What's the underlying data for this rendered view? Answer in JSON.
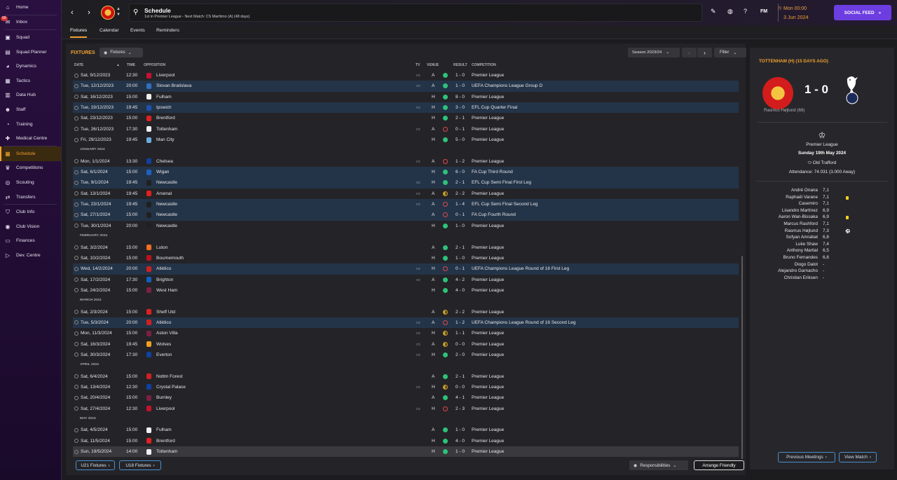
{
  "sidebar": {
    "items": [
      {
        "label": "Home",
        "icon": "home-icon",
        "glyph": "⌂"
      },
      {
        "label": "Inbox",
        "icon": "inbox-icon",
        "glyph": "✉",
        "badge": "99"
      },
      {
        "label": "Squad",
        "icon": "squad-icon",
        "glyph": "▣"
      },
      {
        "label": "Squad Planner",
        "icon": "squad-planner-icon",
        "glyph": "▤"
      },
      {
        "label": "Dynamics",
        "icon": "dynamics-icon",
        "glyph": "◕"
      },
      {
        "label": "Tactics",
        "icon": "tactics-icon",
        "glyph": "▦"
      },
      {
        "label": "Data Hub",
        "icon": "data-hub-icon",
        "glyph": "▥"
      },
      {
        "label": "Staff",
        "icon": "staff-icon",
        "glyph": "☻"
      },
      {
        "label": "Training",
        "icon": "training-icon",
        "glyph": "◔"
      },
      {
        "label": "Medical Centre",
        "icon": "medical-icon",
        "glyph": "✚"
      },
      {
        "label": "Schedule",
        "icon": "calendar-icon",
        "glyph": "▦",
        "active": true
      },
      {
        "label": "Competitions",
        "icon": "trophy-icon",
        "glyph": "♛"
      },
      {
        "label": "Scouting",
        "icon": "scouting-icon",
        "glyph": "◎"
      },
      {
        "label": "Transfers",
        "icon": "transfers-icon",
        "glyph": "⇄"
      },
      {
        "label": "Club Info",
        "icon": "shield-icon",
        "glyph": "⛉"
      },
      {
        "label": "Club Vision",
        "icon": "eye-icon",
        "glyph": "◉"
      },
      {
        "label": "Finances",
        "icon": "finances-icon",
        "glyph": "▭"
      },
      {
        "label": "Dev. Centre",
        "icon": "dev-centre-icon",
        "glyph": "▷"
      }
    ]
  },
  "header": {
    "title": "Schedule",
    "subtitle": "1st in Premier League - Next Match: CS Marítimo (A) (48 days)",
    "date_time": "Mon 00:00",
    "date": "3 Jun 2024",
    "fm_label": "FM",
    "social_feed": "SOCIAL FEED"
  },
  "tabs": [
    "Fixtures",
    "Calendar",
    "Events",
    "Reminders"
  ],
  "fixtures": {
    "heading": "FIXTURES",
    "view_dropdown": "Fixtures",
    "season": "Season 2023/24",
    "filter": "Filter",
    "columns": {
      "date": "DATE",
      "time": "TIME",
      "opposition": "OPPOSITION",
      "tv": "TV",
      "venue": "VENUE",
      "result": "RESULT",
      "competition": "COMPETITION"
    },
    "rows": [
      {
        "date": "Sat, 9/12/2023",
        "time": "12:30",
        "opp": "Liverpool",
        "tv": true,
        "venue": "A",
        "res": "W",
        "score": "1 - 0",
        "comp": "Premier League",
        "color": "#c8102e"
      },
      {
        "date": "Tue, 12/12/2023",
        "time": "20:00",
        "opp": "Slovan Bratislava",
        "tv": true,
        "venue": "A",
        "res": "W",
        "score": "1 - 0",
        "comp": "UEFA Champions League Group D",
        "color": "#3070c0",
        "hl": true
      },
      {
        "date": "Sat, 16/12/2023",
        "time": "15:00",
        "opp": "Fulham",
        "tv": false,
        "venue": "H",
        "res": "W",
        "score": "8 - 0",
        "comp": "Premier League",
        "color": "#f0f0f0"
      },
      {
        "date": "Tue, 19/12/2023",
        "time": "19:45",
        "opp": "Ipswich",
        "tv": true,
        "venue": "H",
        "res": "W",
        "score": "3 - 0",
        "comp": "EFL Cup Quarter Final",
        "color": "#2050b0",
        "hl": true
      },
      {
        "date": "Sat, 23/12/2023",
        "time": "15:00",
        "opp": "Brentford",
        "tv": false,
        "venue": "H",
        "res": "W",
        "score": "2 - 1",
        "comp": "Premier League",
        "color": "#e02020"
      },
      {
        "date": "Tue, 26/12/2023",
        "time": "17:30",
        "opp": "Tottenham",
        "tv": true,
        "venue": "A",
        "res": "L",
        "score": "0 - 1",
        "comp": "Premier League",
        "color": "#f0f0f0"
      },
      {
        "date": "Fri, 29/12/2023",
        "time": "19:45",
        "opp": "Man City",
        "tv": false,
        "venue": "H",
        "res": "W",
        "score": "5 - 0",
        "comp": "Premier League",
        "color": "#6cabdd"
      },
      {
        "month": "JANUARY 2024"
      },
      {
        "date": "Mon, 1/1/2024",
        "time": "13:30",
        "opp": "Chelsea",
        "tv": true,
        "venue": "A",
        "res": "L",
        "score": "1 - 2",
        "comp": "Premier League",
        "color": "#1040a0"
      },
      {
        "date": "Sat, 6/1/2024",
        "time": "15:00",
        "opp": "Wigan",
        "tv": false,
        "venue": "H",
        "res": "W",
        "score": "6 - 0",
        "comp": "FA Cup Third Round",
        "color": "#2060c0",
        "hl": true
      },
      {
        "date": "Tue, 9/1/2024",
        "time": "19:45",
        "opp": "Newcastle",
        "tv": true,
        "venue": "H",
        "res": "W",
        "score": "2 - 1",
        "comp": "EFL Cup Semi Final First Leg",
        "color": "#202020",
        "hl": true
      },
      {
        "date": "Sat, 13/1/2024",
        "time": "19:45",
        "opp": "Arsenal",
        "tv": true,
        "venue": "A",
        "res": "D",
        "score": "2 - 2",
        "comp": "Premier League",
        "color": "#e02020"
      },
      {
        "date": "Tue, 23/1/2024",
        "time": "19:45",
        "opp": "Newcastle",
        "tv": true,
        "venue": "A",
        "res": "L",
        "score": "1 - 4",
        "comp": "EFL Cup Semi Final Second Leg",
        "color": "#202020",
        "hl": true
      },
      {
        "date": "Sat, 27/1/2024",
        "time": "15:00",
        "opp": "Newcastle",
        "tv": false,
        "venue": "A",
        "res": "L",
        "score": "0 - 1",
        "comp": "FA Cup Fourth Round",
        "color": "#202020",
        "hl": true
      },
      {
        "date": "Tue, 30/1/2024",
        "time": "20:00",
        "opp": "Newcastle",
        "tv": false,
        "venue": "H",
        "res": "W",
        "score": "1 - 0",
        "comp": "Premier League",
        "color": "#202020"
      },
      {
        "month": "FEBRUARY 2024"
      },
      {
        "date": "Sat, 3/2/2024",
        "time": "15:00",
        "opp": "Luton",
        "tv": false,
        "venue": "A",
        "res": "W",
        "score": "2 - 1",
        "comp": "Premier League",
        "color": "#f07020"
      },
      {
        "date": "Sat, 10/2/2024",
        "time": "15:00",
        "opp": "Bournemouth",
        "tv": false,
        "venue": "H",
        "res": "W",
        "score": "1 - 0",
        "comp": "Premier League",
        "color": "#c01020"
      },
      {
        "date": "Wed, 14/2/2024",
        "time": "20:00",
        "opp": "Atlético",
        "tv": true,
        "venue": "H",
        "res": "L",
        "score": "0 - 1",
        "comp": "UEFA Champions League Round of 16 First Leg",
        "color": "#d02020",
        "hl": true
      },
      {
        "date": "Sat, 17/2/2024",
        "time": "17:30",
        "opp": "Brighton",
        "tv": true,
        "venue": "A",
        "res": "W",
        "score": "4 - 2",
        "comp": "Premier League",
        "color": "#1060c0"
      },
      {
        "date": "Sat, 24/2/2024",
        "time": "15:00",
        "opp": "West Ham",
        "tv": false,
        "venue": "H",
        "res": "W",
        "score": "4 - 0",
        "comp": "Premier League",
        "color": "#7a2040"
      },
      {
        "month": "MARCH 2024"
      },
      {
        "date": "Sat, 2/3/2024",
        "time": "15:00",
        "opp": "Sheff Utd",
        "tv": false,
        "venue": "A",
        "res": "D",
        "score": "2 - 2",
        "comp": "Premier League",
        "color": "#e02020"
      },
      {
        "date": "Tue, 5/3/2024",
        "time": "20:00",
        "opp": "Atlético",
        "tv": true,
        "venue": "A",
        "res": "L",
        "score": "1 - 2",
        "comp": "UEFA Champions League Round of 16 Second Leg",
        "color": "#d02020",
        "hl": true
      },
      {
        "date": "Mon, 11/3/2024",
        "time": "15:00",
        "opp": "Aston Villa",
        "tv": true,
        "venue": "H",
        "res": "D",
        "score": "1 - 1",
        "comp": "Premier League",
        "color": "#7a2040"
      },
      {
        "date": "Sat, 16/3/2024",
        "time": "19:45",
        "opp": "Wolves",
        "tv": true,
        "venue": "A",
        "res": "D",
        "score": "0 - 0",
        "comp": "Premier League",
        "color": "#f0a020"
      },
      {
        "date": "Sat, 30/3/2024",
        "time": "17:30",
        "opp": "Everton",
        "tv": true,
        "venue": "H",
        "res": "W",
        "score": "2 - 0",
        "comp": "Premier League",
        "color": "#1040a0"
      },
      {
        "month": "APRIL 2024"
      },
      {
        "date": "Sat, 6/4/2024",
        "time": "15:00",
        "opp": "Nottm Forest",
        "tv": false,
        "venue": "A",
        "res": "W",
        "score": "2 - 1",
        "comp": "Premier League",
        "color": "#d02020"
      },
      {
        "date": "Sat, 13/4/2024",
        "time": "12:30",
        "opp": "Crystal Palace",
        "tv": true,
        "venue": "H",
        "res": "D",
        "score": "0 - 0",
        "comp": "Premier League",
        "color": "#1040a0"
      },
      {
        "date": "Sat, 20/4/2024",
        "time": "15:00",
        "opp": "Burnley",
        "tv": false,
        "venue": "A",
        "res": "W",
        "score": "4 - 1",
        "comp": "Premier League",
        "color": "#7a2040"
      },
      {
        "date": "Sat, 27/4/2024",
        "time": "12:30",
        "opp": "Liverpool",
        "tv": true,
        "venue": "H",
        "res": "L",
        "score": "2 - 3",
        "comp": "Premier League",
        "color": "#c8102e"
      },
      {
        "month": "MAY 2024"
      },
      {
        "date": "Sat, 4/5/2024",
        "time": "15:00",
        "opp": "Fulham",
        "tv": false,
        "venue": "A",
        "res": "W",
        "score": "1 - 0",
        "comp": "Premier League",
        "color": "#f0f0f0"
      },
      {
        "date": "Sat, 11/5/2024",
        "time": "15:00",
        "opp": "Brentford",
        "tv": false,
        "venue": "H",
        "res": "W",
        "score": "4 - 0",
        "comp": "Premier League",
        "color": "#e02020"
      },
      {
        "date": "Sun, 19/5/2024",
        "time": "14:00",
        "opp": "Tottenham",
        "tv": false,
        "venue": "H",
        "res": "W",
        "score": "1 - 0",
        "comp": "Premier League",
        "color": "#f0f0f0",
        "last": true
      }
    ],
    "u21": "U21 Fixtures",
    "u18": "U18 Fixtures",
    "responsibilities": "Responsibilities",
    "arrange_friendly": "Arrange Friendly"
  },
  "match_panel": {
    "title": "TOTTENHAM (H) (15 DAYS AGO)",
    "score": "1 - 0",
    "scorer": "Rasmus Højlund (66)",
    "competition": "Premier League",
    "date": "Sunday 19th May 2024",
    "stadium": "Old Trafford",
    "attendance": "Attendance: 74.031 (3.000 Away)",
    "players": [
      {
        "name": "André Onana",
        "rating": "7,1"
      },
      {
        "name": "Raphaël Varane",
        "rating": "7,1",
        "card": true
      },
      {
        "name": "Casemiro",
        "rating": "7,1"
      },
      {
        "name": "Lisandro Martínez",
        "rating": "6,9"
      },
      {
        "name": "Aaron Wan-Bissaka",
        "rating": "6,9",
        "card": true
      },
      {
        "name": "Marcus Rashford",
        "rating": "7,1"
      },
      {
        "name": "Rasmus Højlund",
        "rating": "7,3",
        "goal": true
      },
      {
        "name": "Sofyan Amrabat",
        "rating": "6,8"
      },
      {
        "name": "Luke Shaw",
        "rating": "7,4"
      },
      {
        "name": "Anthony Martial",
        "rating": "6,5"
      },
      {
        "name": "Bruno Fernandes",
        "rating": "6,6"
      },
      {
        "name": "Diogo Dalot",
        "rating": "-"
      },
      {
        "name": "Alejandro Garnacho",
        "rating": "-"
      },
      {
        "name": "Christian Eriksen",
        "rating": "-"
      }
    ],
    "previous_meetings": "Previous Meetings",
    "view_match": "View Match"
  },
  "colors": {
    "accent": "#f0a030",
    "win": "#2ec27a",
    "loss": "#e04848",
    "draw": "#d0a020",
    "highlight": "#243448",
    "social": "#6c3de0"
  }
}
